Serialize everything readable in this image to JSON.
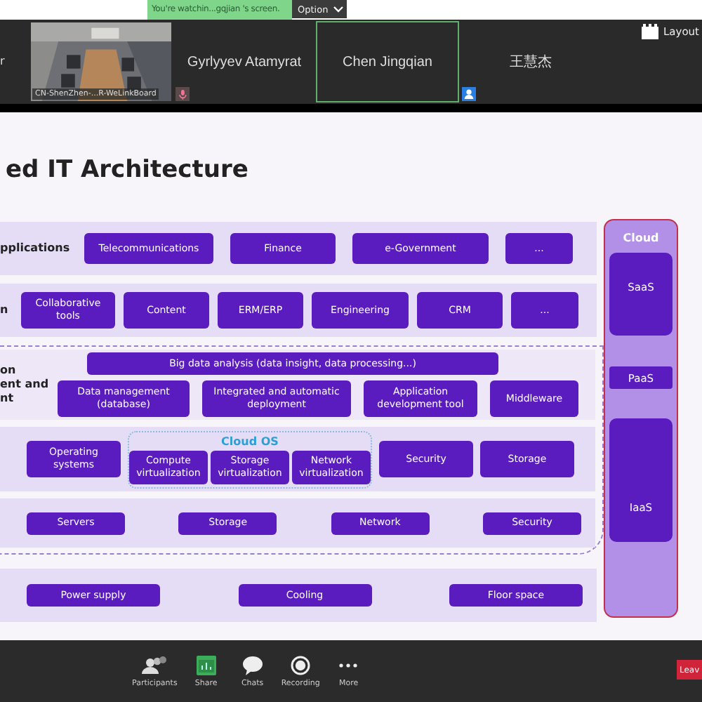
{
  "banner": {
    "text": "You're watchin...gqjian 's screen.",
    "option": "Option"
  },
  "layout_button": "Layout",
  "edge_text": "r",
  "tiles": [
    {
      "kind": "video",
      "name": "CN-ShenZhen-...R-WeLinkBoard",
      "speaking": false,
      "muted": false,
      "host": false
    },
    {
      "kind": "name",
      "name": "Gyrlyyev Atamyrat",
      "speaking": false,
      "muted": true,
      "host": false
    },
    {
      "kind": "name",
      "name": "Chen Jingqian",
      "speaking": true,
      "muted": false,
      "host": false
    },
    {
      "kind": "name",
      "name": "王慧杰",
      "speaking": false,
      "muted": false,
      "host": true
    }
  ],
  "slide": {
    "title": "ed IT Architecture",
    "layers_top": [
      {
        "kind": "plain",
        "label": [
          "pplications"
        ],
        "items": [
          "Telecommunications",
          "Finance",
          "e-Government",
          "..."
        ]
      },
      {
        "kind": "plain",
        "label": [
          "n"
        ],
        "items": [
          "Collaborative tools",
          "Content",
          "ERM/ERP",
          "Engineering",
          "CRM",
          "..."
        ]
      }
    ],
    "scope": [
      {
        "kind": "analysis",
        "label": [
          "on",
          "ent and",
          "nt"
        ],
        "banner": "Big data analysis (data insight, data processing...)",
        "items": [
          "Data management (database)",
          "Integrated and automatic deployment",
          "Application development tool",
          "Middleware"
        ]
      },
      {
        "kind": "os",
        "items": [
          {
            "kind": "box",
            "text": "Operating systems"
          },
          {
            "kind": "group",
            "title": "Cloud OS",
            "items": [
              "Compute virtualization",
              "Storage virtualization",
              "Network virtualization"
            ]
          },
          {
            "kind": "box",
            "text": "Security"
          },
          {
            "kind": "box",
            "text": "Storage"
          }
        ]
      },
      {
        "kind": "spread",
        "items": [
          "Servers",
          "Storage",
          "Network",
          "Security"
        ]
      }
    ],
    "layers_bottom": [
      {
        "kind": "spread",
        "items": [
          "Power supply",
          "Cooling",
          "Floor space"
        ]
      }
    ],
    "cloud": {
      "title": "Cloud",
      "tiers": [
        "SaaS",
        "PaaS",
        "IaaS"
      ]
    }
  },
  "toolbar": [
    {
      "kind": "participants",
      "label": "Participants"
    },
    {
      "kind": "share",
      "label": "Share"
    },
    {
      "kind": "chats",
      "label": "Chats"
    },
    {
      "kind": "recording",
      "label": "Recording"
    },
    {
      "kind": "more",
      "label": "More"
    }
  ],
  "leave": "Leav"
}
